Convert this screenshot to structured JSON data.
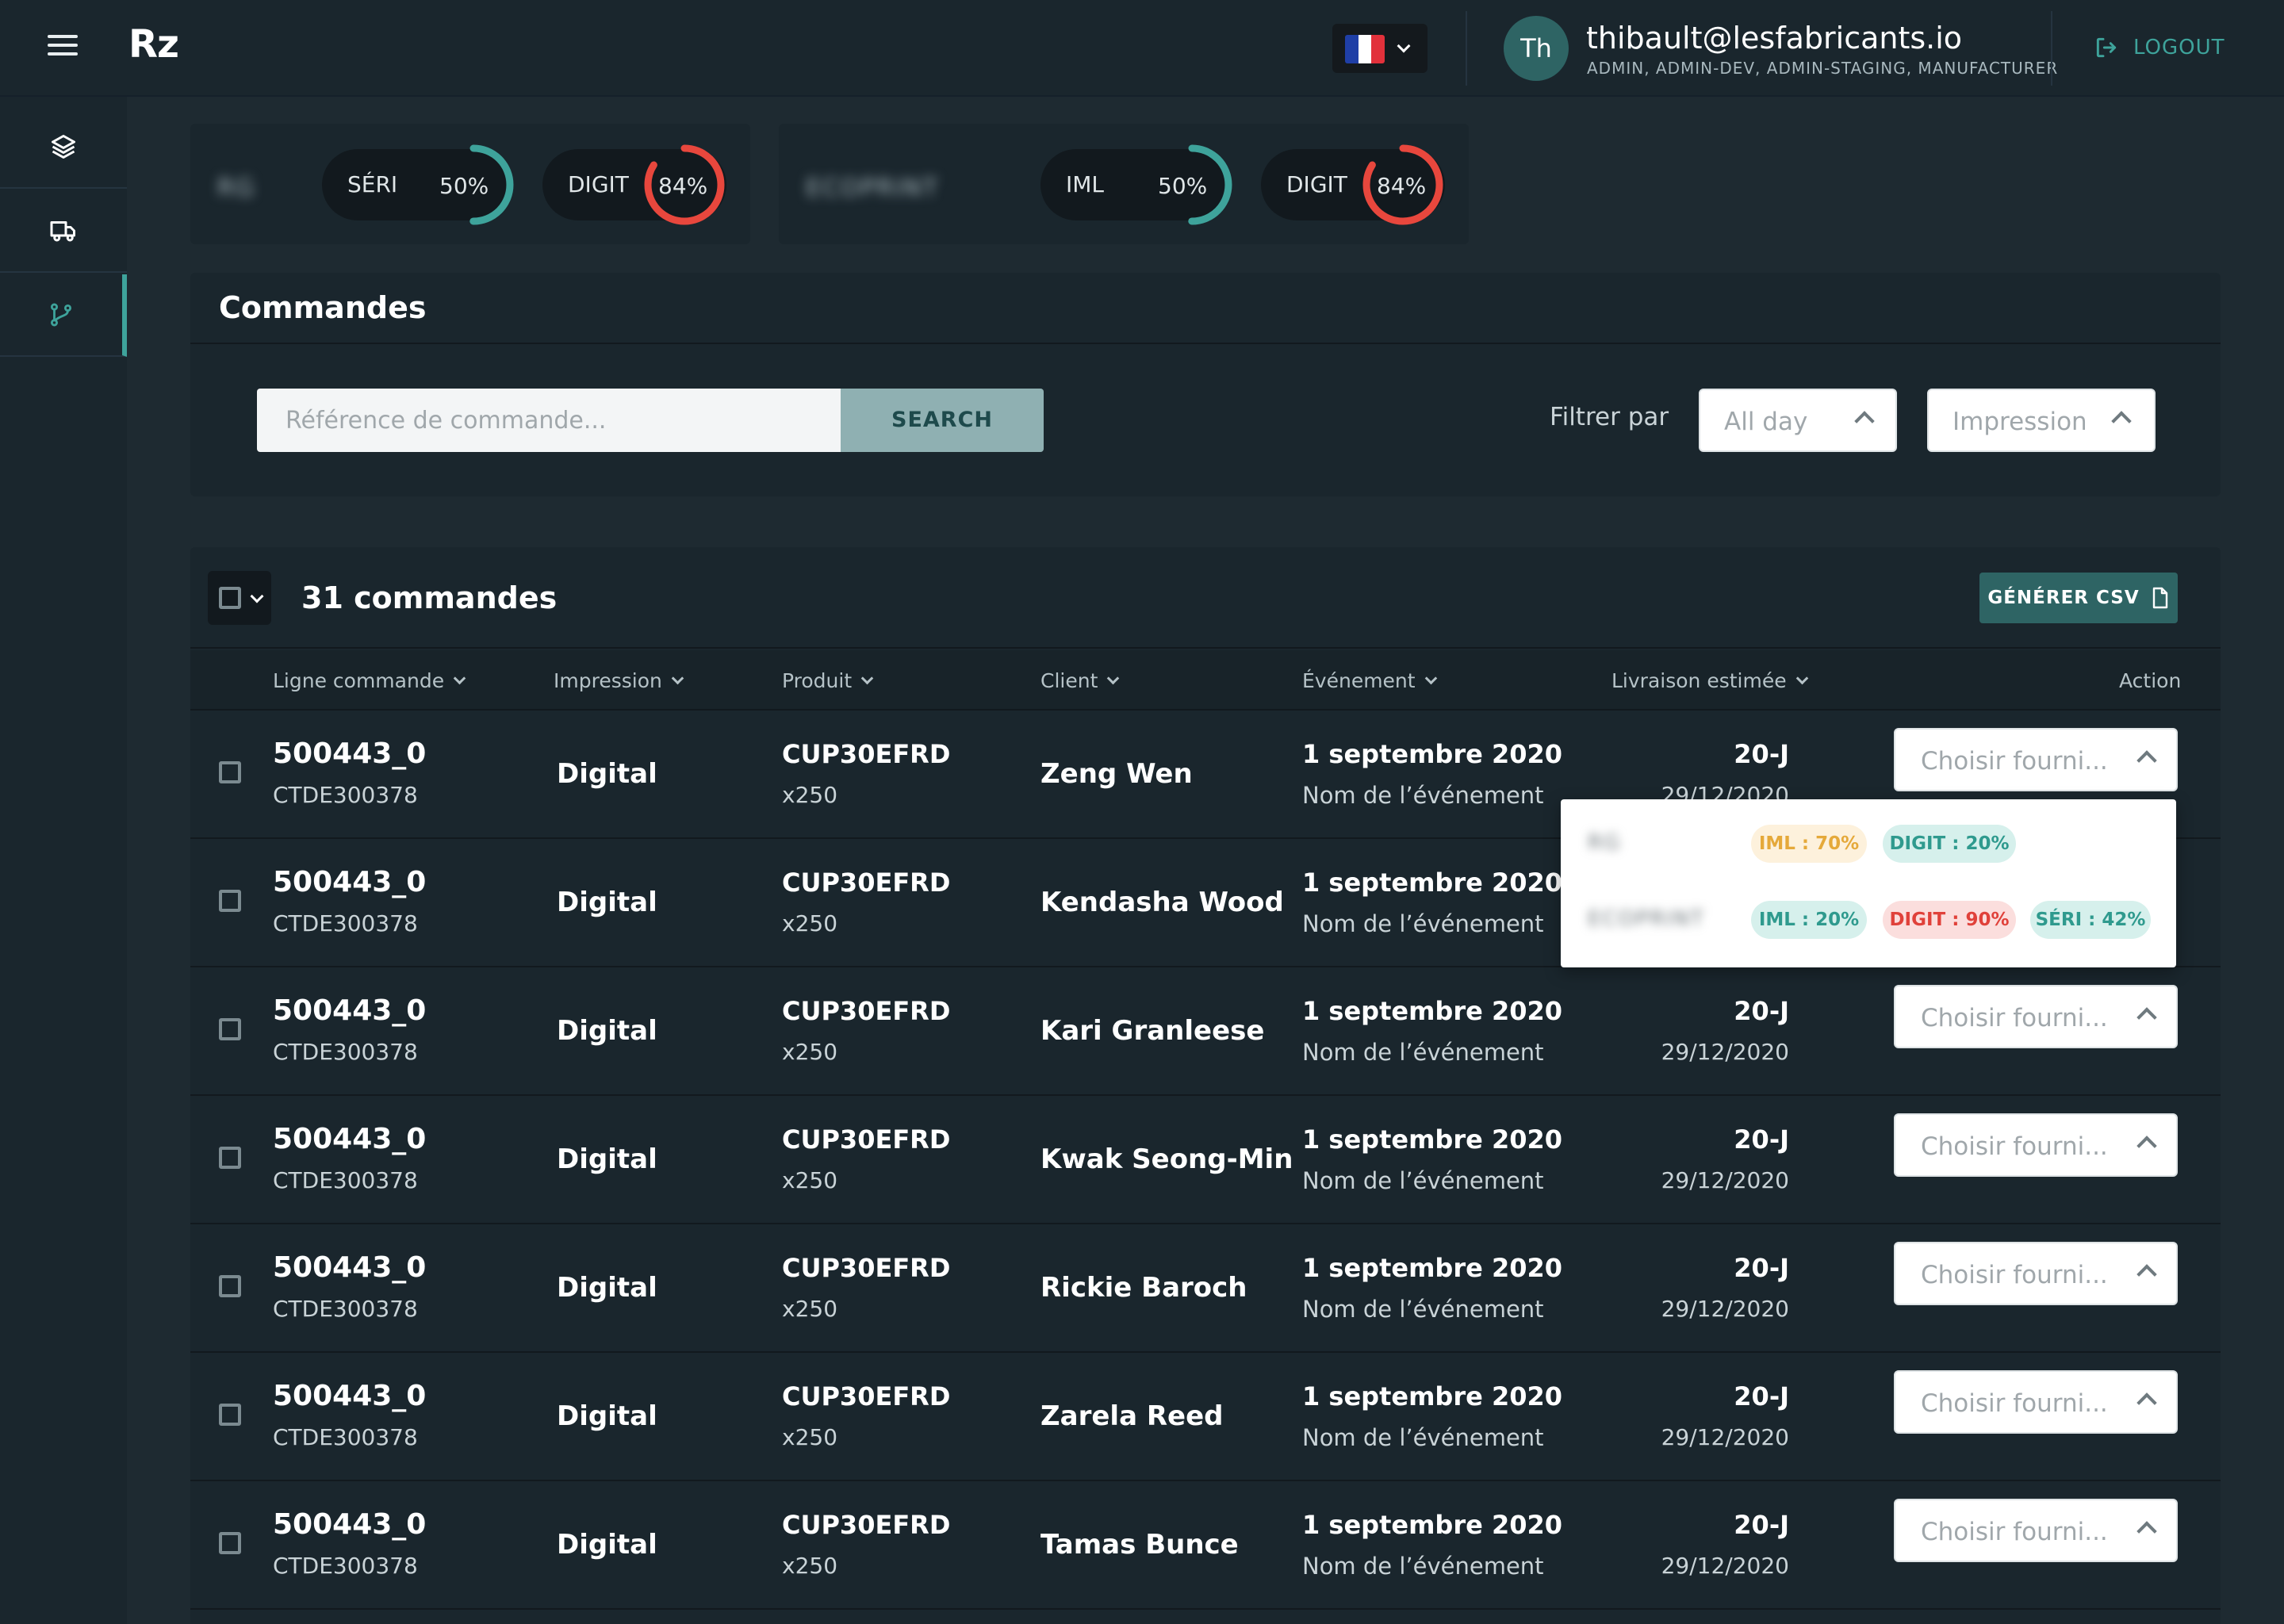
{
  "topbar": {
    "brand": "Rz",
    "user_initials": "Th",
    "user_email": "thibault@lesfabricants.io",
    "user_roles": "ADMIN, ADMIN-DEV, ADMIN-STAGING, MANUFACTURER",
    "logout_label": "LOGOUT",
    "language_flag": "flag-fr-icon"
  },
  "sidebar": {
    "items": [
      {
        "icon": "layers-icon",
        "active": false
      },
      {
        "icon": "truck-icon",
        "active": false
      },
      {
        "icon": "git-branch-icon",
        "active": true
      }
    ]
  },
  "suppliers": [
    {
      "name": "RG",
      "stats": [
        {
          "label": "SÉRI",
          "value": "50%",
          "percent": 50,
          "color": "#3ea39b"
        },
        {
          "label": "DIGIT",
          "value": "84%",
          "percent": 84,
          "color": "#e8473d"
        }
      ]
    },
    {
      "name": "ECOPRINT",
      "stats": [
        {
          "label": "IML",
          "value": "50%",
          "percent": 50,
          "color": "#3ea39b"
        },
        {
          "label": "DIGIT",
          "value": "84%",
          "percent": 84,
          "color": "#e8473d"
        }
      ]
    }
  ],
  "orders_panel": {
    "title": "Commandes",
    "search_placeholder": "Référence de commande...",
    "search_button": "SEARCH",
    "filter_label": "Filtrer par",
    "filter_period": "All day",
    "filter_type": "Impression"
  },
  "table": {
    "count_label": "31 commandes",
    "csv_button": "GÉNÉRER CSV",
    "columns": [
      "Ligne commande",
      "Impression",
      "Produit",
      "Client",
      "Événement",
      "Livraison estimée",
      "Action"
    ],
    "rows": [
      {
        "ref": "500443_0",
        "ref2": "CTDE300378",
        "impression": "Digital",
        "product": "CUP30EFRD",
        "qty": "x250",
        "client": "Zeng Wen",
        "date": "1 septembre 2020",
        "event": "Nom de l’événement",
        "days": "20-J",
        "delivery": "29/12/2020",
        "action": "Choisir fourni..."
      },
      {
        "ref": "500443_0",
        "ref2": "CTDE300378",
        "impression": "Digital",
        "product": "CUP30EFRD",
        "qty": "x250",
        "client": "Kendasha Wood",
        "date": "1 septembre 2020",
        "event": "Nom de l’événement",
        "days": "",
        "delivery": "",
        "action": ""
      },
      {
        "ref": "500443_0",
        "ref2": "CTDE300378",
        "impression": "Digital",
        "product": "CUP30EFRD",
        "qty": "x250",
        "client": "Kari Granleese",
        "date": "1 septembre 2020",
        "event": "Nom de l’événement",
        "days": "20-J",
        "delivery": "29/12/2020",
        "action": "Choisir fourni..."
      },
      {
        "ref": "500443_0",
        "ref2": "CTDE300378",
        "impression": "Digital",
        "product": "CUP30EFRD",
        "qty": "x250",
        "client": "Kwak Seong-Min",
        "date": "1 septembre 2020",
        "event": "Nom de l’événement",
        "days": "20-J",
        "delivery": "29/12/2020",
        "action": "Choisir fourni..."
      },
      {
        "ref": "500443_0",
        "ref2": "CTDE300378",
        "impression": "Digital",
        "product": "CUP30EFRD",
        "qty": "x250",
        "client": "Rickie Baroch",
        "date": "1 septembre 2020",
        "event": "Nom de l’événement",
        "days": "20-J",
        "delivery": "29/12/2020",
        "action": "Choisir fourni..."
      },
      {
        "ref": "500443_0",
        "ref2": "CTDE300378",
        "impression": "Digital",
        "product": "CUP30EFRD",
        "qty": "x250",
        "client": "Zarela Reed",
        "date": "1 septembre 2020",
        "event": "Nom de l’événement",
        "days": "20-J",
        "delivery": "29/12/2020",
        "action": "Choisir fourni..."
      },
      {
        "ref": "500443_0",
        "ref2": "CTDE300378",
        "impression": "Digital",
        "product": "CUP30EFRD",
        "qty": "x250",
        "client": "Tamas Bunce",
        "date": "1 septembre 2020",
        "event": "Nom de l’événement",
        "days": "20-J",
        "delivery": "29/12/2020",
        "action": "Choisir fourni..."
      }
    ]
  },
  "supplier_dropdown": {
    "options": [
      {
        "name": "RG",
        "tags": [
          {
            "label": "IML : 70%",
            "bg": "#fdf1dc",
            "fg": "#e5a93a"
          },
          {
            "label": "DIGIT : 20%",
            "bg": "#d6f0ec",
            "fg": "#2f9a8e"
          }
        ]
      },
      {
        "name": "ECOPRINT",
        "tags": [
          {
            "label": "IML : 20%",
            "bg": "#d6f0ec",
            "fg": "#2f9a8e"
          },
          {
            "label": "DIGIT : 90%",
            "bg": "#fbdedd",
            "fg": "#e0413a"
          },
          {
            "label": "SÉRI : 42%",
            "bg": "#d6f0ec",
            "fg": "#2f9a8e"
          }
        ]
      }
    ]
  }
}
